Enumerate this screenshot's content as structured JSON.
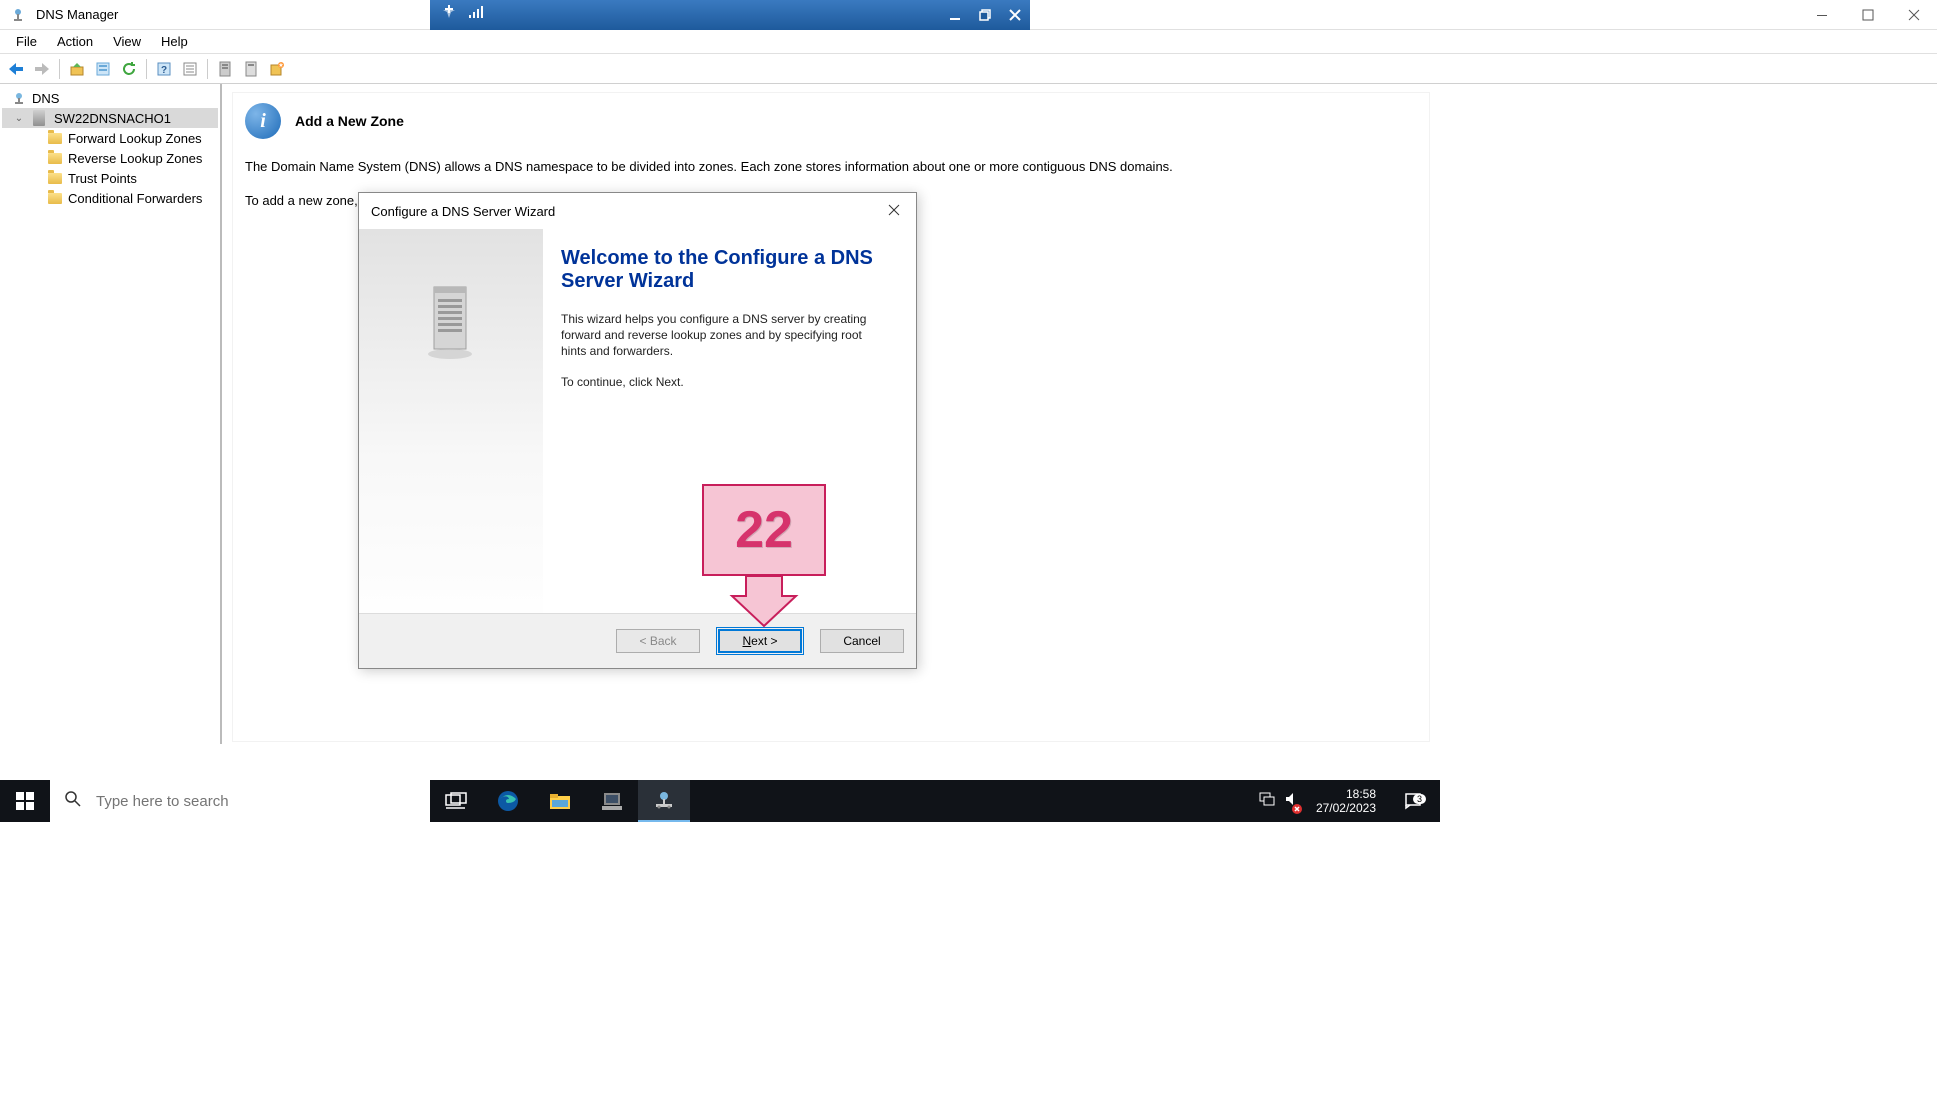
{
  "window": {
    "title": "DNS Manager"
  },
  "menubar": {
    "file": "File",
    "action": "Action",
    "view": "View",
    "help": "Help"
  },
  "tree": {
    "root": "DNS",
    "server": "SW22DNSNACHO1",
    "flz": "Forward Lookup Zones",
    "rlz": "Reverse Lookup Zones",
    "tp": "Trust Points",
    "cf": "Conditional Forwarders"
  },
  "content": {
    "heading": "Add a New Zone",
    "body": "The Domain Name System (DNS) allows a DNS namespace to be divided into zones. Each zone stores information about one or more contiguous DNS domains.",
    "partial": "To add a new zone,"
  },
  "wizard": {
    "title": "Configure a DNS Server Wizard",
    "heading": "Welcome to the Configure a DNS Server Wizard",
    "p1": "This wizard helps you configure a DNS server by creating forward and reverse lookup zones and by specifying root hints and forwarders.",
    "p2": "To continue, click Next.",
    "back": "< Back",
    "next": "Next >",
    "cancel": "Cancel"
  },
  "callout": {
    "num": "22"
  },
  "taskbar": {
    "search_placeholder": "Type here to search",
    "time": "18:58",
    "date": "27/02/2023",
    "notif_count": "3"
  }
}
